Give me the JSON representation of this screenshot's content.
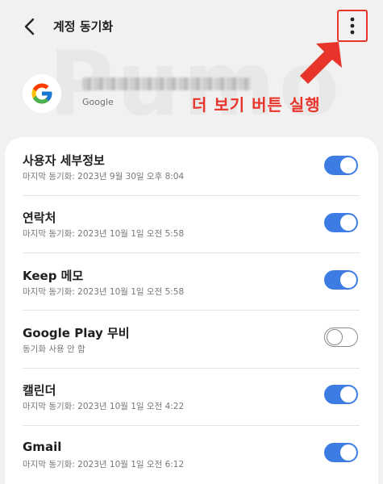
{
  "header": {
    "title": "계정 동기화",
    "back_icon": "chevron-left-icon",
    "more_icon": "more-vert-icon"
  },
  "watermark": "Pumo",
  "account": {
    "provider": "Google",
    "email_note": "blurred"
  },
  "annotation": {
    "text": "더 보기 버튼 실행",
    "color": "#e8342b"
  },
  "sync_items": [
    {
      "title": "사용자 세부정보",
      "subtitle": "마지막 동기화: 2023년 9월 30일 오후 8:04",
      "enabled": true
    },
    {
      "title": "연락처",
      "subtitle": "마지막 동기화: 2023년 10월 1일 오전 5:58",
      "enabled": true
    },
    {
      "title": "Keep 메모",
      "subtitle": "마지막 동기화: 2023년 10월 1일 오전 5:58",
      "enabled": true
    },
    {
      "title": "Google Play 무비",
      "subtitle": "동기화 사용 안 함",
      "enabled": false
    },
    {
      "title": "캘린더",
      "subtitle": "마지막 동기화: 2023년 10월 1일 오전 4:22",
      "enabled": true
    },
    {
      "title": "Gmail",
      "subtitle": "마지막 동기화: 2023년 10월 1일 오전 6:12",
      "enabled": true
    }
  ],
  "colors": {
    "toggle_on": "#3d7de3",
    "background": "#f1f1f1",
    "accent_red": "#e8342b"
  }
}
